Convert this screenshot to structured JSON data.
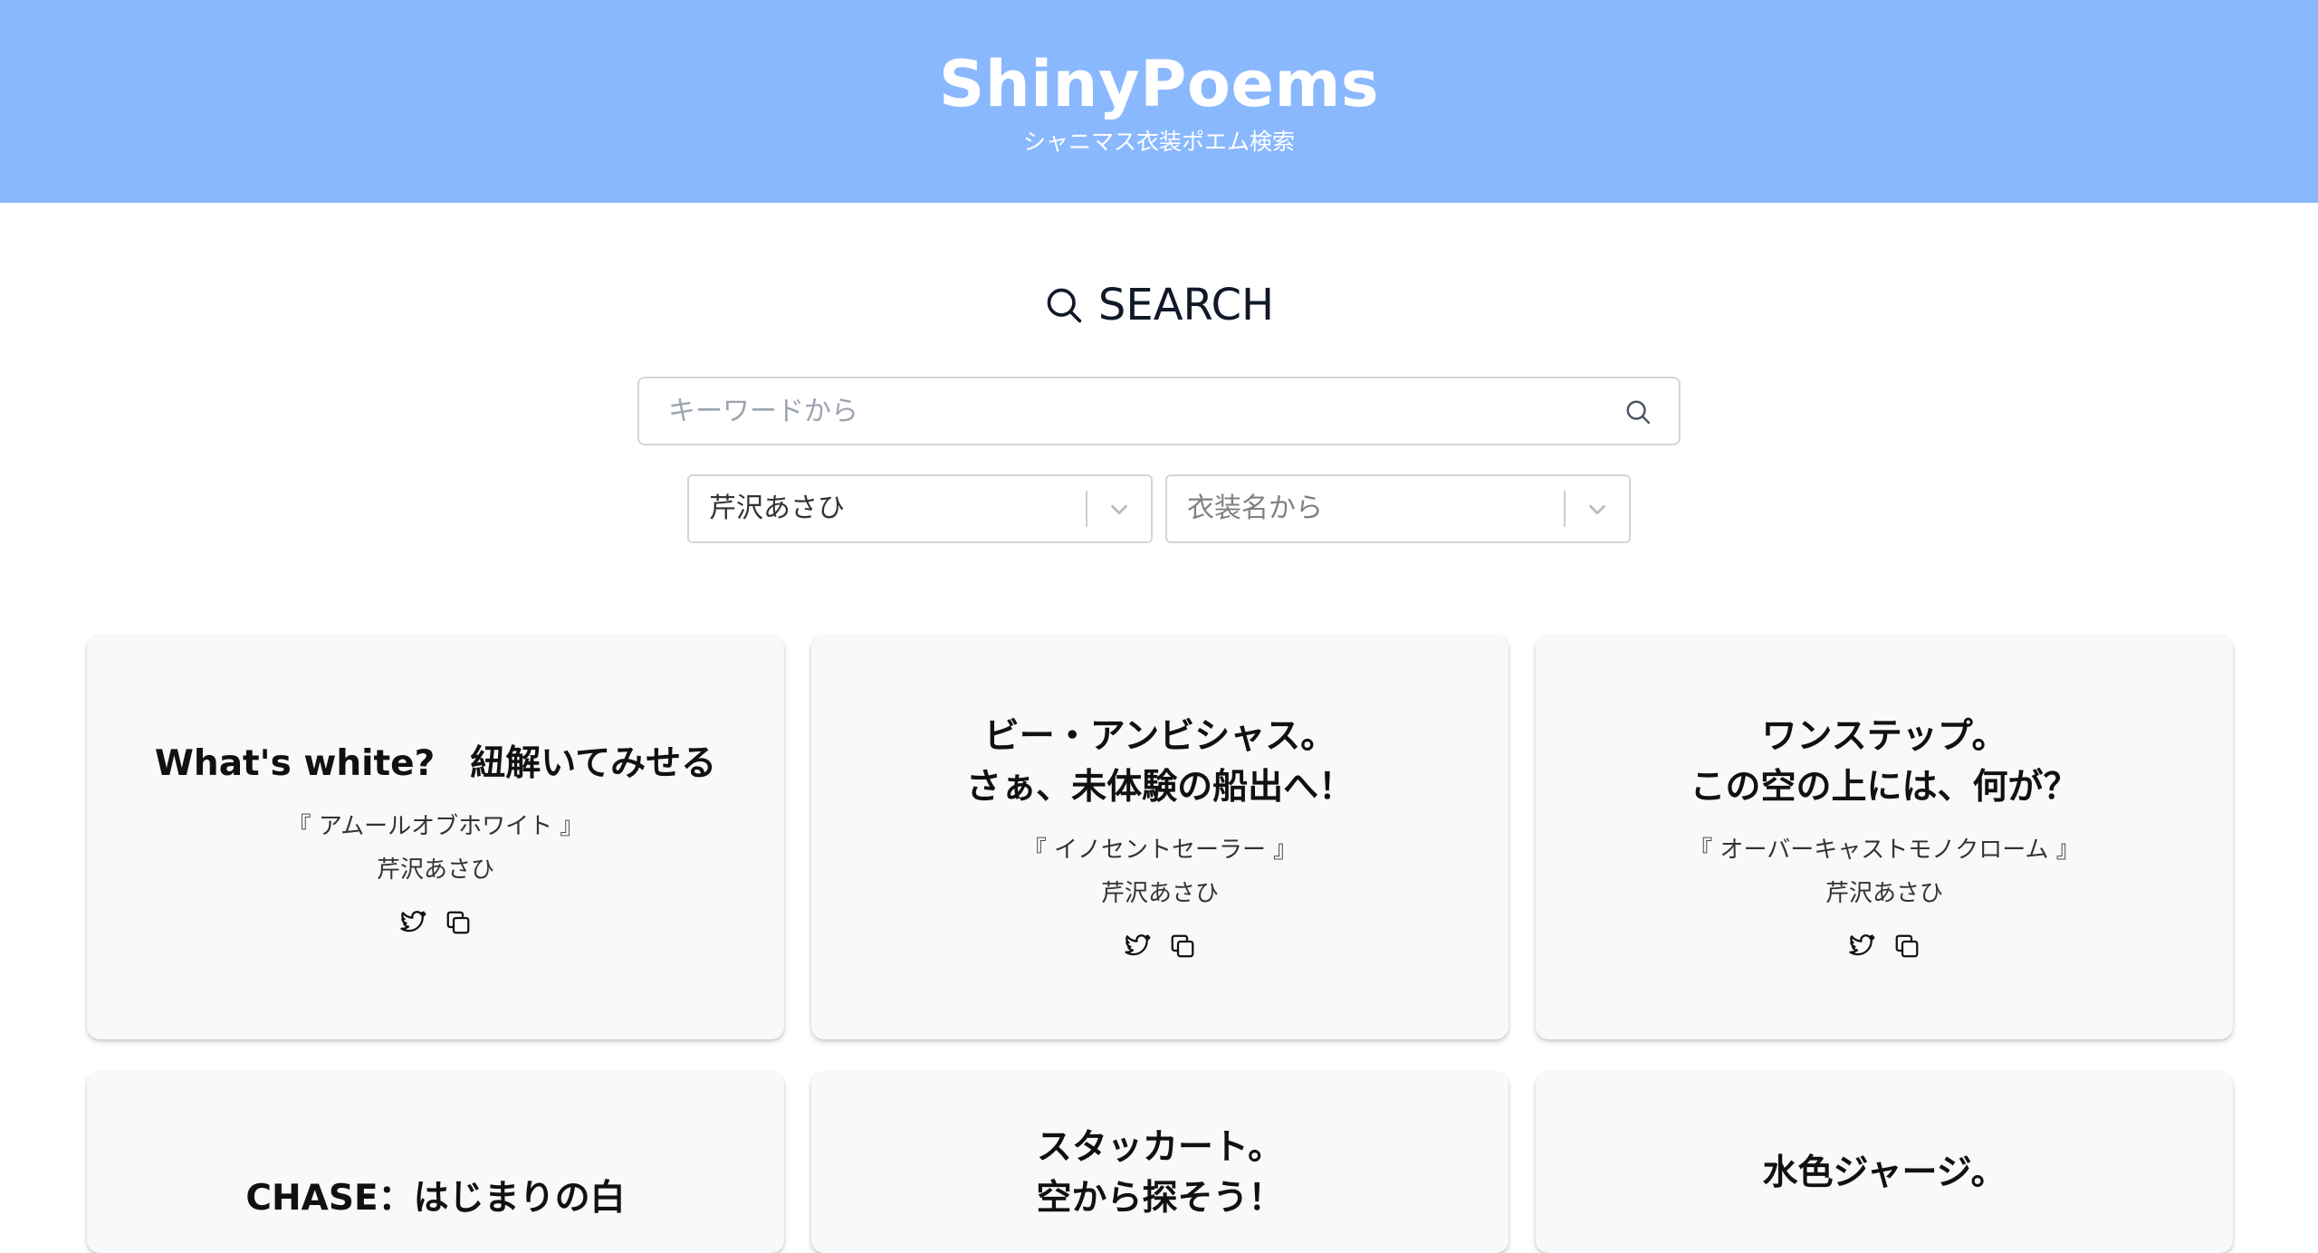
{
  "header": {
    "title": "ShinyPoems",
    "subtitle": "シャニマス衣装ポエム検索"
  },
  "search": {
    "heading": "SEARCH",
    "keyword_placeholder": "キーワードから",
    "idol_select_value": "芹沢あさひ",
    "costume_select_placeholder": "衣装名から"
  },
  "cards": [
    {
      "poem": "What's white?　紐解いてみせる",
      "costume": "『 アムールオブホワイト 』",
      "idol": "芹沢あさひ"
    },
    {
      "poem": "ビー・アンビシャス。\nさぁ、未体験の船出へ！",
      "costume": "『 イノセントセーラー 』",
      "idol": "芹沢あさひ"
    },
    {
      "poem": "ワンステップ。\nこの空の上には、何が？",
      "costume": "『 オーバーキャストモノクローム 』",
      "idol": "芹沢あさひ"
    },
    {
      "poem": "CHASE：はじまりの白"
    },
    {
      "poem": "スタッカート。\n空から探そう！"
    },
    {
      "poem": "水色ジャージ。"
    }
  ],
  "icons": {
    "search": "search-icon",
    "chevron": "chevron-down-icon",
    "twitter": "twitter-icon",
    "copy": "copy-icon"
  },
  "colors": {
    "header_background": "#8ab8fe",
    "card_background": "#f8f9fa"
  }
}
